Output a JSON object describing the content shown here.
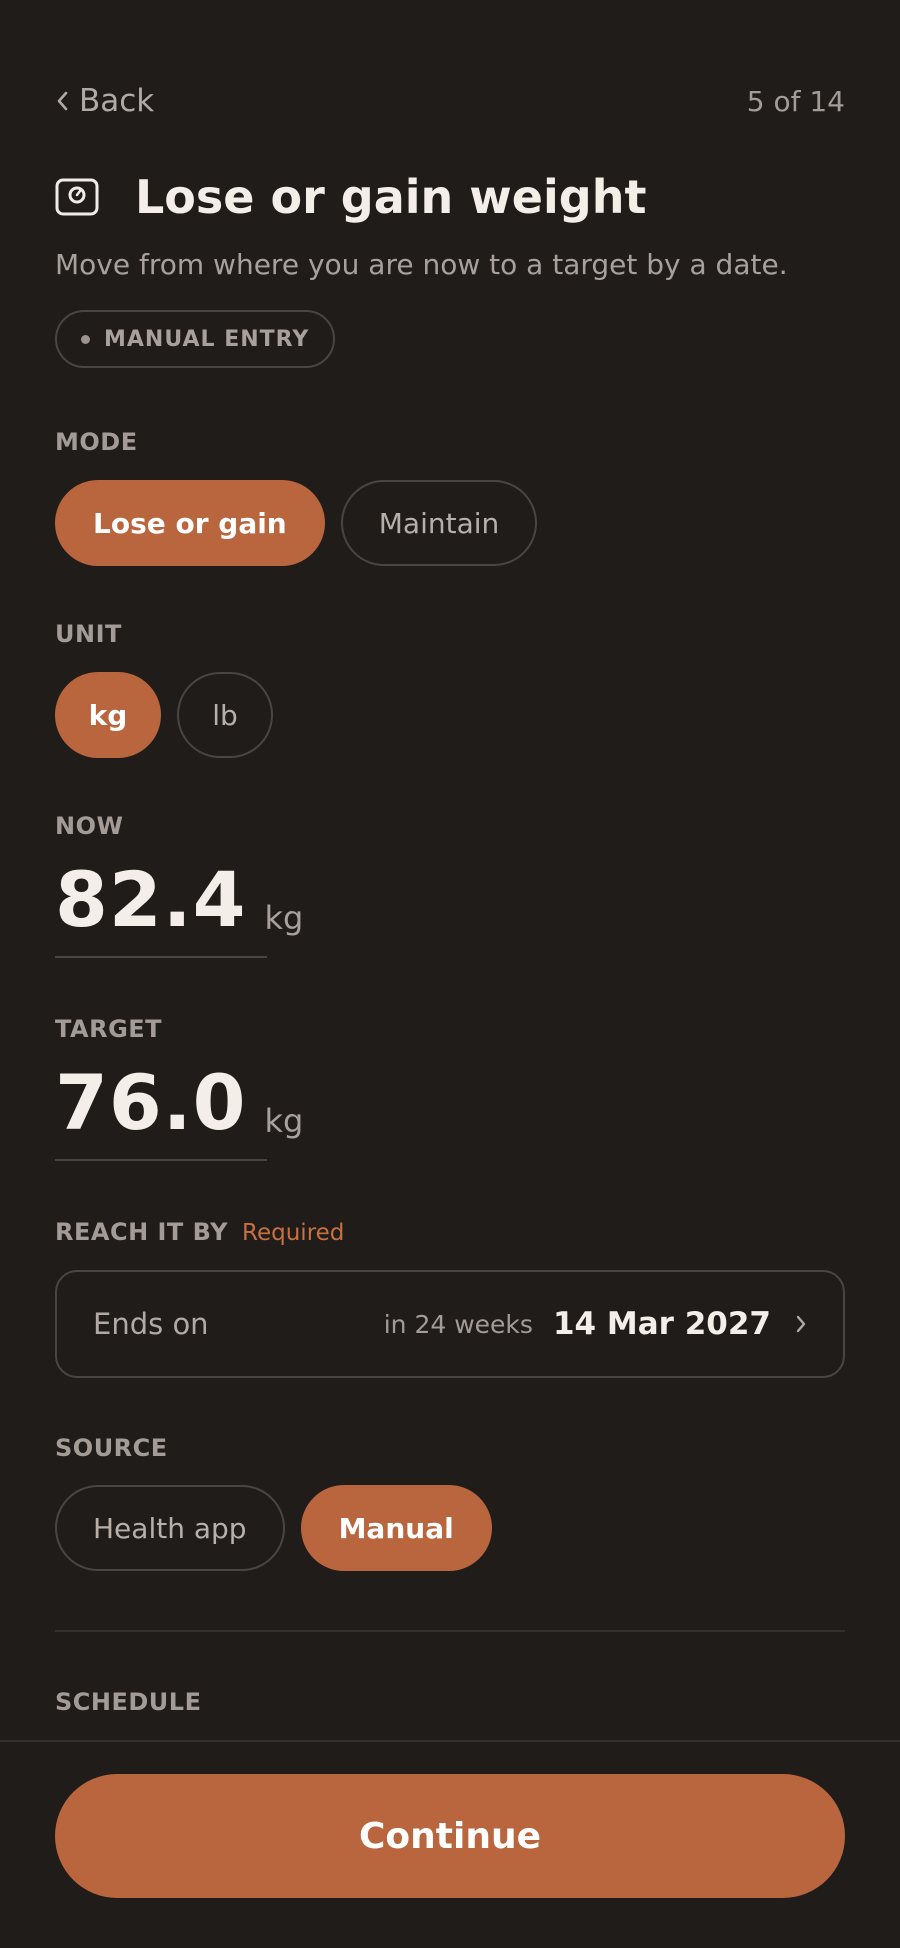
{
  "header": {
    "back_label": "Back",
    "step": "5 of 14"
  },
  "goal": {
    "icon": "scale-icon",
    "title": "Lose or gain weight",
    "subtitle": "Move from where you are now to a target by a date.",
    "badge": "MANUAL ENTRY"
  },
  "mode": {
    "label": "MODE",
    "options": [
      "Lose or gain",
      "Maintain"
    ],
    "selected": "Lose or gain"
  },
  "unit": {
    "label": "UNIT",
    "options": [
      "kg",
      "lb"
    ],
    "selected": "kg"
  },
  "now": {
    "label": "NOW",
    "value": "82.4",
    "unit": "kg"
  },
  "target": {
    "label": "TARGET",
    "value": "76.0",
    "unit": "kg"
  },
  "deadline": {
    "label": "REACH IT BY",
    "required": "Required",
    "field_label": "Ends on",
    "relative": "in 24 weeks",
    "date": "14 Mar 2027"
  },
  "source": {
    "label": "SOURCE",
    "options": [
      "Health app",
      "Manual"
    ],
    "selected": "Manual"
  },
  "schedule": {
    "label": "SCHEDULE"
  },
  "footer": {
    "continue_label": "Continue"
  },
  "colors": {
    "background": "#1f1c1a",
    "accent": "#b9653d",
    "required": "#c8703f"
  }
}
